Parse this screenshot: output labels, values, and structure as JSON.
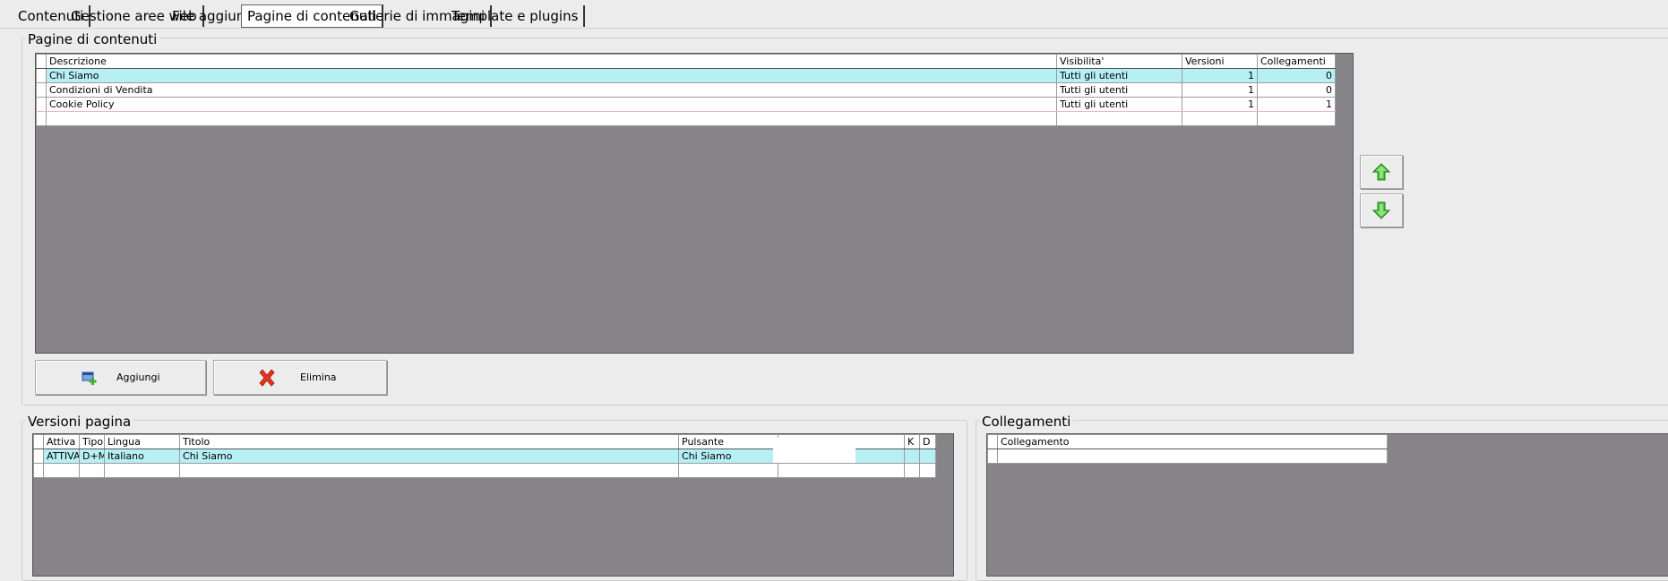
{
  "tabs": [
    {
      "label": "Contenuti"
    },
    {
      "label": "Gestione aree web"
    },
    {
      "label": "File aggiuntivi"
    },
    {
      "label": "Pagine di contenuti"
    },
    {
      "label": "Gallerie di immagini"
    },
    {
      "label": "Template e plugins"
    }
  ],
  "pages_group": {
    "title": "Pagine di contenuti",
    "columns": [
      "Descrizione",
      "Visibilita'",
      "Versioni",
      "Collegamenti"
    ],
    "rows": [
      {
        "descrizione": "Chi Siamo",
        "visibilita": "Tutti gli utenti",
        "versioni": "1",
        "collegamenti": "0"
      },
      {
        "descrizione": "Condizioni di Vendita",
        "visibilita": "Tutti gli utenti",
        "versioni": "1",
        "collegamenti": "0"
      },
      {
        "descrizione": "Cookie Policy",
        "visibilita": "Tutti gli utenti",
        "versioni": "1",
        "collegamenti": "1"
      }
    ],
    "add_label": "Aggiungi",
    "delete_label": "Elimina"
  },
  "versions_group": {
    "title": "Versioni pagina",
    "columns": [
      "Attiva",
      "Tipo",
      "Lingua",
      "Titolo",
      "Pulsante",
      "",
      "K",
      "D"
    ],
    "rows": [
      {
        "attiva": "ATTIVA",
        "tipo": "D+M",
        "lingua": "Italiano",
        "titolo": "Chi Siamo",
        "pulsante": "Chi Siamo"
      }
    ]
  },
  "links_group": {
    "title": "Collegamenti",
    "columns": [
      "Collegamento"
    ]
  },
  "icons": {
    "add": "add-window-icon",
    "delete": "red-x-icon",
    "up": "green-up-arrow-icon",
    "down": "green-down-arrow-icon"
  },
  "colors": {
    "selected_row": "#b6f0f5",
    "grid_background": "#868489",
    "arrow_green": "#4cc23a",
    "delete_red": "#e8321f"
  }
}
